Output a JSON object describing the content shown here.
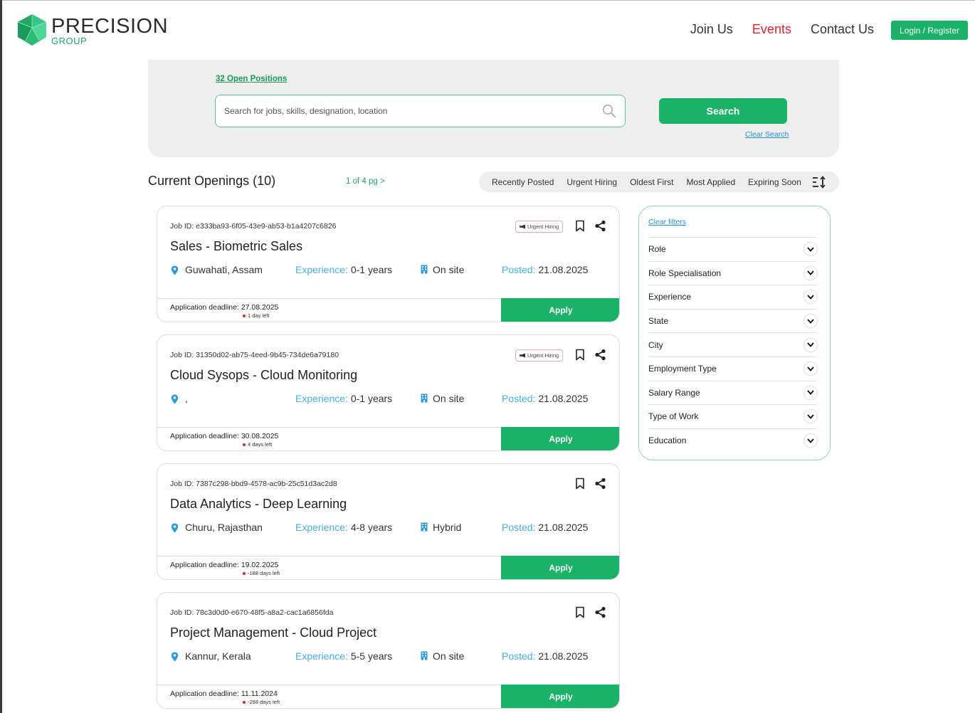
{
  "brand": {
    "name": "PRECISION",
    "sub": "GROUP"
  },
  "nav": {
    "join": "Join Us",
    "events": "Events",
    "contact": "Contact Us",
    "login": "Login / Register"
  },
  "search": {
    "open_positions": "32 Open Positions",
    "placeholder": "Search for jobs, skills, designation, location",
    "button": "Search",
    "clear": "Clear Search"
  },
  "openings": {
    "title": "Current Openings (10)",
    "pager": "1 of 4 pg  >",
    "sort_options": [
      "Recently Posted",
      "Urgent Hiring",
      "Oldest First",
      "Most Applied",
      "Expiring Soon"
    ]
  },
  "labels": {
    "experience": "Experience:",
    "posted": "Posted:",
    "deadline_prefix": "Application deadline: ",
    "apply": "Apply",
    "urgent": "Urgent Hiring"
  },
  "jobs": [
    {
      "id": "Job ID: e333ba93-6f05-43e9-ab53-b1a4207c6826",
      "title": "Sales - Biometric Sales",
      "location": "Guwahati, Assam",
      "experience": "0-1 years",
      "work": "On site",
      "posted": "21.08.2025",
      "deadline": "Application deadline: 27.08.2025",
      "days_left": "1 day left",
      "urgent": true
    },
    {
      "id": "Job ID: 31350d02-ab75-4eed-9b45-734de6a79180",
      "title": "Cloud Sysops - Cloud Monitoring",
      "location": ",",
      "experience": "0-1 years",
      "work": "On site",
      "posted": "21.08.2025",
      "deadline": "Application deadline: 30.08.2025",
      "days_left": "4 days left",
      "urgent": true
    },
    {
      "id": "Job ID: 7387c298-bbd9-4578-ac9b-25c51d3ac2d8",
      "title": "Data Analytics - Deep Learning",
      "location": "Churu, Rajasthan",
      "experience": "4-8 years",
      "work": "Hybrid",
      "posted": "21.08.2025",
      "deadline": "Application deadline: 19.02.2025",
      "days_left": "-188 days left",
      "urgent": false
    },
    {
      "id": "Job ID: 78c3d0d0-e670-48f5-a8a2-cac1a6856fda",
      "title": "Project Management - Cloud Project",
      "location": "Kannur, Kerala",
      "experience": "5-5 years",
      "work": "On site",
      "posted": "21.08.2025",
      "deadline": "Application deadline: 11.11.2024",
      "days_left": "-288 days left",
      "urgent": false
    }
  ],
  "filters": {
    "clear": "Clear filters",
    "items": [
      "Role",
      "Role Specialisation",
      "Experience",
      "State",
      "City",
      "Employment Type",
      "Salary Range",
      "Type of Work",
      "Education"
    ]
  },
  "colors": {
    "brand_green": "#1ab266",
    "events_red": "#e0242f",
    "label_blue": "#4aaee2",
    "link_blue": "#2b8fd8"
  }
}
